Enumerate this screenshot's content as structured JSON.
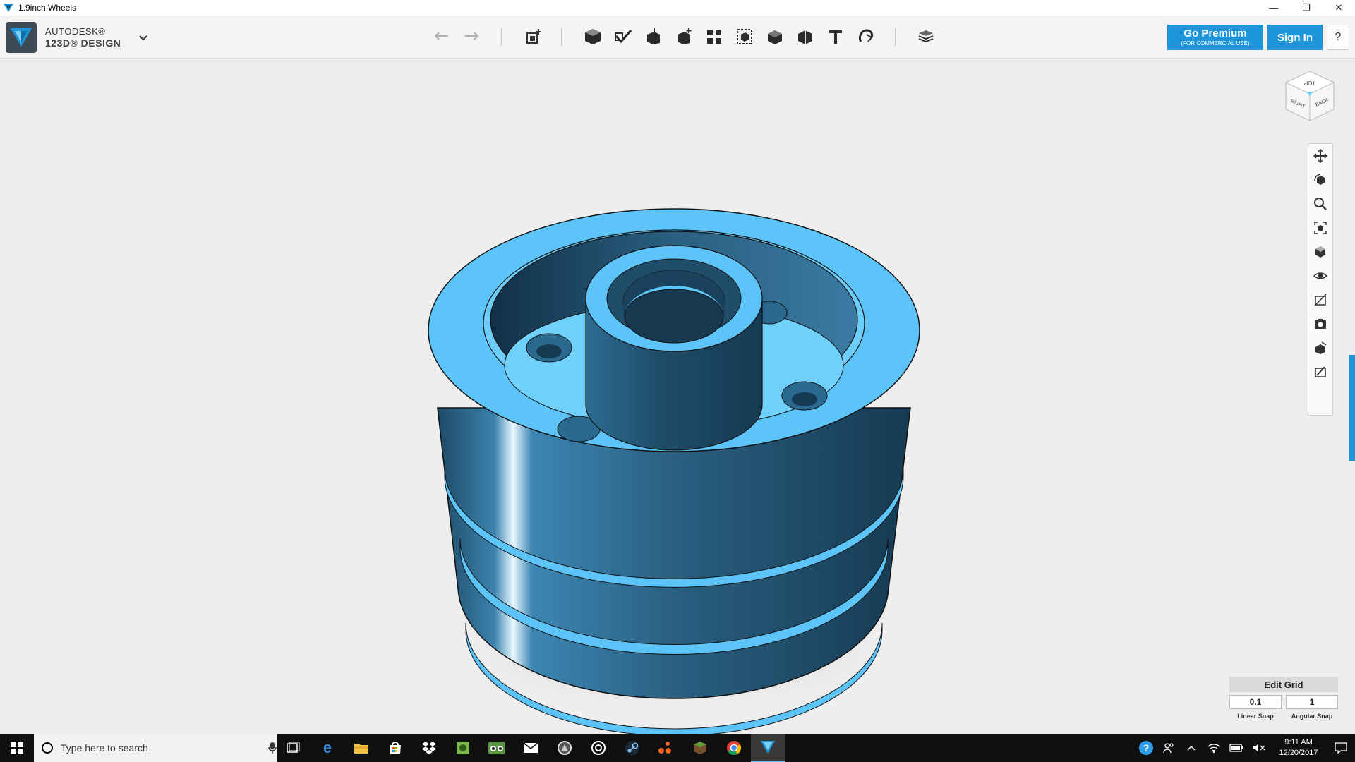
{
  "window": {
    "title": "1.9inch Wheels",
    "controls": {
      "minimize": "—",
      "restore": "❐",
      "close": "✕"
    }
  },
  "app": {
    "brand_line1": "AUTODESK®",
    "brand_line2": "123D® DESIGN",
    "menu_chevron": "⌄"
  },
  "toolbar": {
    "undo": "undo-icon",
    "redo": "redo-icon",
    "tools": [
      "transform",
      "primitives",
      "sketch",
      "construct",
      "modify",
      "pattern",
      "grouping",
      "combine",
      "measure",
      "text",
      "snap",
      "material"
    ],
    "premium_label": "Go Premium",
    "premium_sub": "(FOR COMMERCIAL USE)",
    "signin_label": "Sign In",
    "help_label": "?"
  },
  "viewcube": {
    "top": "TOP",
    "right": "RIGHT",
    "back": "BACK"
  },
  "navbar": [
    "pan",
    "orbit",
    "zoom",
    "fit",
    "views",
    "visibility",
    "materials-outlines",
    "screenshot",
    "grid-toggle",
    "snap-toggle"
  ],
  "grid": {
    "title": "Edit Grid",
    "linear_value": "0.1",
    "linear_label": "Linear Snap",
    "angular_value": "1",
    "angular_label": "Angular Snap"
  },
  "taskbar": {
    "search_placeholder": "Type here to search",
    "time": "9:11 AM",
    "date": "12/20/2017"
  },
  "colors": {
    "model_light": "#5cc4f8",
    "model_dark": "#1f4d6a",
    "accent": "#1d95d8"
  }
}
